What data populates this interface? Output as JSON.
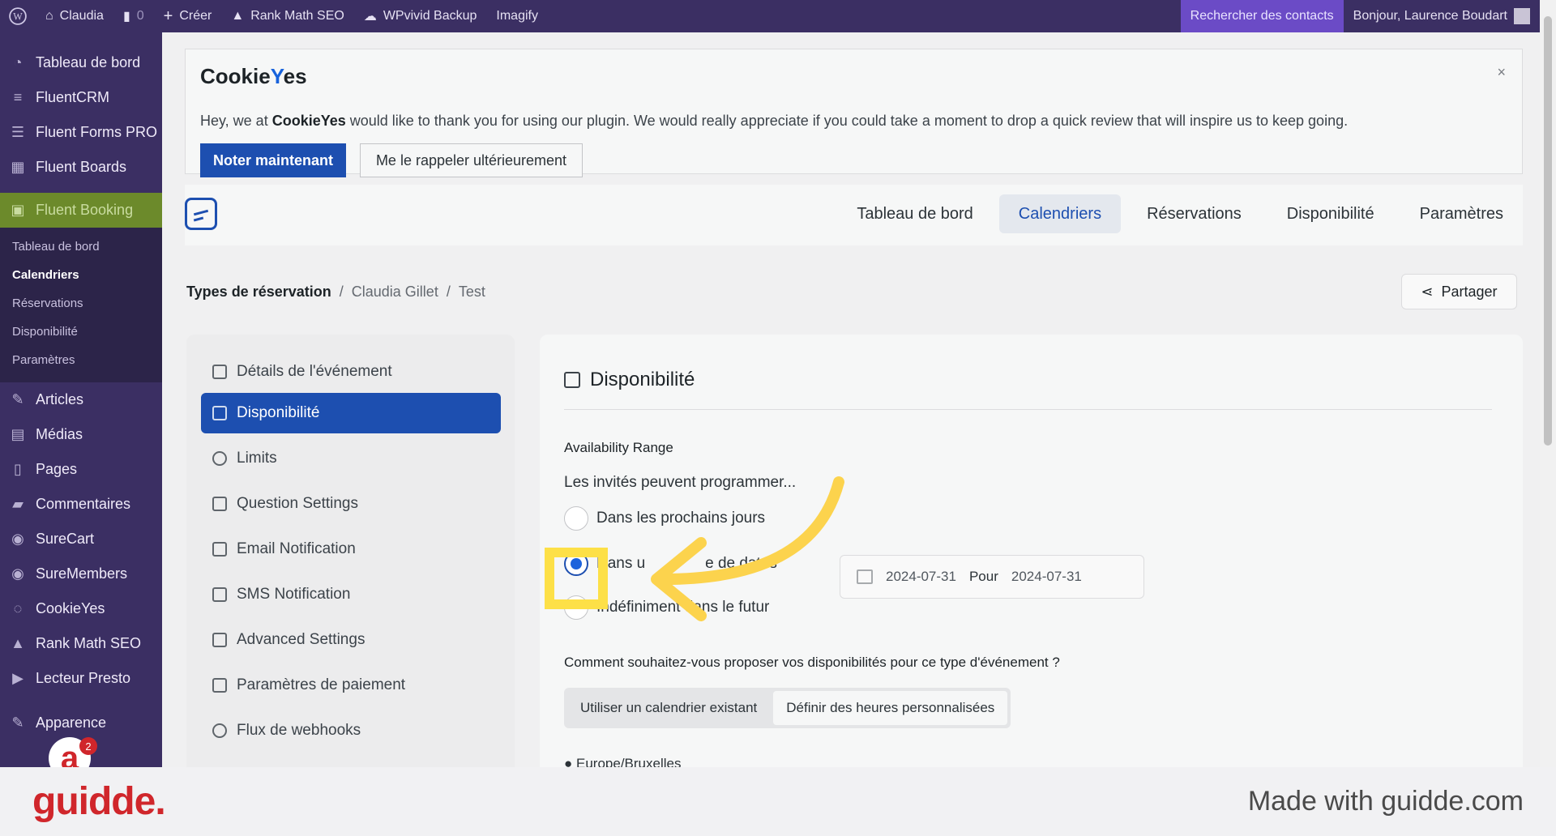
{
  "adminbar": {
    "site_name": "Claudia",
    "comments_count": "0",
    "create_label": "Créer",
    "rankmath_label": "Rank Math SEO",
    "wpvivid_label": "WPvivid Backup",
    "imagify_label": "Imagify",
    "search_contacts_label": "Rechercher des contacts",
    "greeting": "Bonjour, Laurence Boudart"
  },
  "sidebar": {
    "top_items": [
      {
        "label": "Tableau de bord"
      },
      {
        "label": "FluentCRM"
      },
      {
        "label": "Fluent Forms PRO"
      },
      {
        "label": "Fluent Boards"
      },
      {
        "label": "Fluent Booking"
      }
    ],
    "submenu": [
      {
        "label": "Tableau de bord"
      },
      {
        "label": "Calendriers"
      },
      {
        "label": "Réservations"
      },
      {
        "label": "Disponibilité"
      },
      {
        "label": "Paramètres"
      }
    ],
    "bottom_items": [
      {
        "label": "Articles"
      },
      {
        "label": "Médias"
      },
      {
        "label": "Pages"
      },
      {
        "label": "Commentaires"
      },
      {
        "label": "SureCart"
      },
      {
        "label": "SureMembers"
      },
      {
        "label": "CookieYes"
      },
      {
        "label": "Rank Math SEO"
      },
      {
        "label": "Lecteur Presto"
      },
      {
        "label": "Apparence"
      }
    ],
    "notification_count": "2"
  },
  "cookieyes": {
    "logo_pre": "Cookie",
    "logo_y": "Y",
    "logo_post": "es",
    "message_pre": "Hey, we at ",
    "message_brand": "CookieYes",
    "message_post": " would like to thank you for using our plugin. We would really appreciate if you could take a moment to drop a quick review that will inspire us to keep going.",
    "rate_now": "Noter maintenant",
    "remind_later": "Me le rappeler ultérieurement",
    "close": "×"
  },
  "fb_nav": {
    "tabs": [
      {
        "label": "Tableau de bord"
      },
      {
        "label": "Calendriers"
      },
      {
        "label": "Réservations"
      },
      {
        "label": "Disponibilité"
      },
      {
        "label": "Paramètres"
      }
    ]
  },
  "breadcrumb": {
    "root": "Types de réservation",
    "sep": "/",
    "calendar": "Claudia Gillet",
    "event": "Test"
  },
  "share_label": "Partager",
  "settings_nav": [
    {
      "label": "Détails de l'événement"
    },
    {
      "label": "Disponibilité"
    },
    {
      "label": "Limits"
    },
    {
      "label": "Question Settings"
    },
    {
      "label": "Email Notification"
    },
    {
      "label": "SMS Notification"
    },
    {
      "label": "Advanced Settings"
    },
    {
      "label": "Paramètres de paiement"
    },
    {
      "label": "Flux de webhooks"
    }
  ],
  "availability": {
    "title": "Disponibilité",
    "range_label": "Availability Range",
    "guests_label": "Les invités peuvent programmer...",
    "options": [
      {
        "label": "Dans les prochains jours",
        "checked": false
      },
      {
        "label": "Dans u              e de dates",
        "checked": true
      },
      {
        "label": "Indéfiniment dans le futur",
        "checked": false
      }
    ],
    "date_from": "2024-07-31",
    "date_to_word": "Pour",
    "date_to": "2024-07-31",
    "question": "Comment souhaitez-vous proposer vos disponibilités pour ce type d'événement ?",
    "mode_options": [
      {
        "label": "Utiliser un calendrier existant",
        "active": false
      },
      {
        "label": "Définir des heures personnalisées",
        "active": true
      }
    ],
    "timezone_partial": "Europe/Bruxelles"
  },
  "footer": {
    "brand": "guidde.",
    "made_with": "Made with guidde.com"
  },
  "colors": {
    "admin_bg": "#3b2f63",
    "primary": "#1d4fb0",
    "highlight": "#fde047",
    "fluent_booking_active": "#6c8a2b",
    "guidde_red": "#d0262b"
  }
}
